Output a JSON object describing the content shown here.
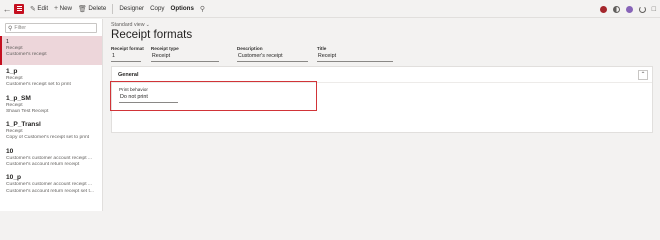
{
  "toolbar": {
    "edit_label": "Edit",
    "new_label": "New",
    "delete_label": "Delete",
    "designer_label": "Designer",
    "copy_label": "Copy",
    "options_label": "Options"
  },
  "filter": {
    "placeholder": "Filter"
  },
  "list": [
    {
      "title": "1",
      "lines": [
        "Receipt",
        "Customer's receipt"
      ],
      "selected": true
    },
    {
      "title": "1_p",
      "lines": [
        "Receipt",
        "Customer's receipt set to print"
      ]
    },
    {
      "title": "1_p_SM",
      "lines": [
        "Receipt",
        "Shaun Test Receipt"
      ]
    },
    {
      "title": "1_P_Transl",
      "lines": [
        "Receipt",
        "Copy of Customer's receipt set to print"
      ]
    },
    {
      "title": "10",
      "lines": [
        "Customer's customer account receipt ...",
        "Customer's account return receipt"
      ]
    },
    {
      "title": "10_p",
      "lines": [
        "Customer's customer account receipt ...",
        "Customer's account return receipt set t..."
      ]
    }
  ],
  "main": {
    "view_label": "Standard view",
    "title": "Receipt formats",
    "fields": [
      {
        "label": "Receipt format",
        "value": "1"
      },
      {
        "label": "Receipt type",
        "value": "Receipt"
      },
      {
        "label": "Description",
        "value": "Customer's receipt"
      },
      {
        "label": "Title",
        "value": "Receipt"
      }
    ],
    "fasttab": {
      "title": "General",
      "print_behavior_label": "Print behavior",
      "print_behavior_value": "Do not print"
    }
  },
  "colors": {
    "accent": "#c50f1f",
    "selected_row": "#edd6da",
    "highlight_box": "#d13438"
  }
}
